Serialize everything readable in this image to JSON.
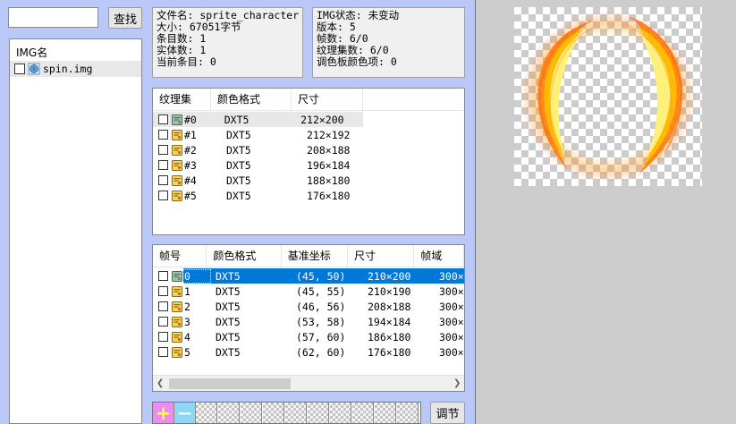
{
  "search": {
    "value": "",
    "button_label": "查找"
  },
  "img_list": {
    "header": "IMG名",
    "items": [
      {
        "name": "spin.img"
      }
    ]
  },
  "file_info": {
    "filename_label": "文件名: sprite_character",
    "size_label": "大小: 67051字节",
    "entries_label": "条目数: 1",
    "entities_label": "实体数: 1",
    "current_label": "当前条目: 0"
  },
  "img_status": {
    "status_label": "IMG状态: 未变动",
    "version_label": "版本: 5",
    "frames_label": "帧数: 6/0",
    "textures_label": "纹理集数: 6/0",
    "palette_label": "调色板颜色项: 0"
  },
  "texture_table": {
    "columns": [
      "纹理集",
      "颜色格式",
      "尺寸"
    ],
    "rows": [
      {
        "id": "#0",
        "format": "DXT5",
        "size": "212×200"
      },
      {
        "id": "#1",
        "format": "DXT5",
        "size": "212×192"
      },
      {
        "id": "#2",
        "format": "DXT5",
        "size": "208×188"
      },
      {
        "id": "#3",
        "format": "DXT5",
        "size": "196×184"
      },
      {
        "id": "#4",
        "format": "DXT5",
        "size": "188×180"
      },
      {
        "id": "#5",
        "format": "DXT5",
        "size": "176×180"
      }
    ]
  },
  "frame_table": {
    "columns": [
      "帧号",
      "颜色格式",
      "基准坐标",
      "尺寸",
      "帧域"
    ],
    "rows": [
      {
        "id": "0",
        "format": "DXT5",
        "base": "(45, 50)",
        "size": "210×200",
        "domain": "300×"
      },
      {
        "id": "1",
        "format": "DXT5",
        "base": "(45, 55)",
        "size": "210×190",
        "domain": "300×"
      },
      {
        "id": "2",
        "format": "DXT5",
        "base": "(46, 56)",
        "size": "208×188",
        "domain": "300×"
      },
      {
        "id": "3",
        "format": "DXT5",
        "base": "(53, 58)",
        "size": "194×184",
        "domain": "300×"
      },
      {
        "id": "4",
        "format": "DXT5",
        "base": "(57, 60)",
        "size": "186×180",
        "domain": "300×"
      },
      {
        "id": "5",
        "format": "DXT5",
        "base": "(62, 60)",
        "size": "176×180",
        "domain": "300×"
      }
    ],
    "selected_row": 0
  },
  "bottom_toolbar": {
    "add_label": "+",
    "remove_label": "−",
    "adjust_label": "调节"
  },
  "colors": {
    "panel_bg": "#b9c8f7",
    "selection": "#0078d7",
    "preview_fire_outer": "#ff7a00",
    "preview_fire_inner": "#ffe96a"
  },
  "icons": {
    "file": "globe-file-icon",
    "texture": "texture-sheet-icon"
  }
}
